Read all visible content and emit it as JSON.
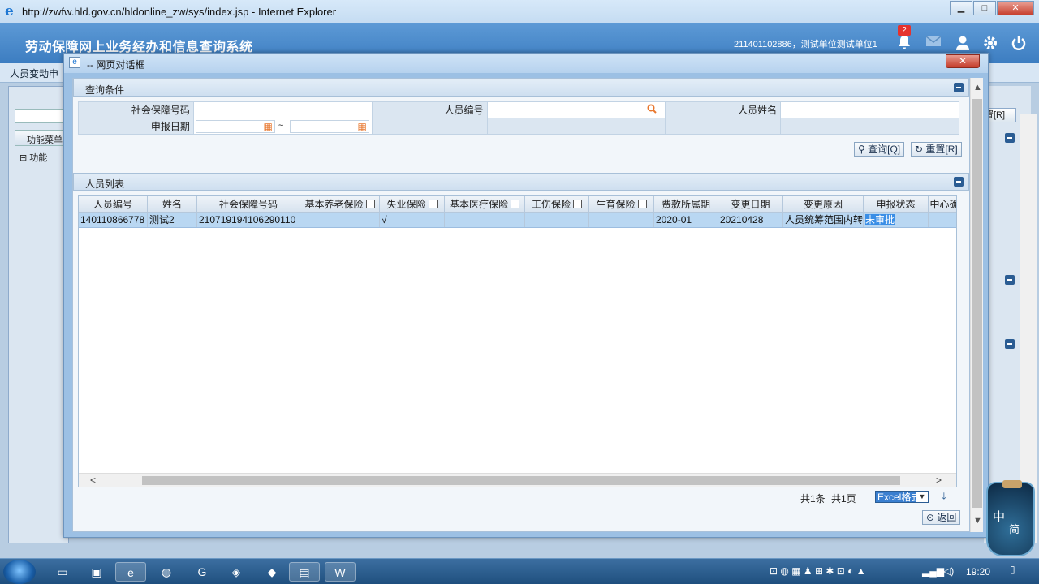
{
  "browser": {
    "title": "http://zwfw.hld.gov.cn/hldonline_zw/sys/index.jsp - Internet Explorer",
    "controls": {
      "min": "▁",
      "max": "□",
      "close": "✕"
    }
  },
  "app": {
    "title": "劳动保障网上业务经办和信息查询系统",
    "user_info": "211401102886，测试单位测试单位1",
    "notification_count": "2",
    "nav_text": "人员变动申"
  },
  "background": {
    "menu_button": "功能菜单",
    "tree_root": "功能",
    "reset_button": "置[R]"
  },
  "dialog": {
    "title": "-- 网页对话框",
    "close": "✕",
    "query_panel": {
      "title": "查询条件",
      "fields": {
        "ssn_label": "社会保障号码",
        "ssn_value": "",
        "person_no_label": "人员编号",
        "person_no_value": "",
        "name_label": "人员姓名",
        "name_value": "",
        "date_label": "申报日期",
        "date_from": "",
        "date_to": "",
        "date_sep": "~"
      },
      "query_button": "查询[Q]",
      "reset_button": "重置[R]"
    },
    "list_panel": {
      "title": "人员列表",
      "columns": [
        "人员编号",
        "姓名",
        "社会保障号码",
        "基本养老保险",
        "失业保险",
        "基本医疗保险",
        "工伤保险",
        "生育保险",
        "费款所属期",
        "变更日期",
        "变更原因",
        "申报状态",
        "中心确"
      ],
      "rows": [
        [
          "140110866778",
          "测试2",
          "210719194106290110",
          "",
          "√",
          "",
          "",
          "",
          "2020-01",
          "20210428",
          "人员统筹范围内转出",
          "未审批",
          ""
        ]
      ],
      "total_records": "共1条",
      "total_pages": "共1页",
      "export_format": "Excel格式",
      "return_button": "返回"
    }
  },
  "taskbar": {
    "clock": "19:20",
    "ime_text_1": "中",
    "ime_text_2": "简"
  },
  "colors": {
    "header_blue": "#3c7dc1",
    "row_selected": "#b9d7f2",
    "accent_orange": "#e8772e"
  }
}
